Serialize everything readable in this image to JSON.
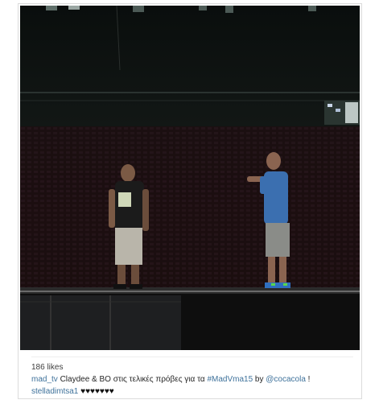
{
  "post": {
    "likes_text": "186 likes",
    "caption": {
      "username": "mad_tv",
      "text_before": " Claydee & BO στις τελικές πρόβες για τα ",
      "hashtag": "#MadVma15",
      "text_middle": " by ",
      "mention": "@cocacola",
      "text_after": " !"
    },
    "comment": {
      "username": "stelladimtsa1",
      "text": " ♥♥♥♥♥♥♥"
    }
  },
  "photo": {
    "icon": "photo-image",
    "colors": {
      "backdrop": "#0d1210",
      "stage": "#1a1a1a",
      "person1_shirt": "#1b1b1b",
      "person1_shorts": "#b9b5aa",
      "person2_shirt": "#3b6fb0",
      "person2_shorts": "#8a8c88"
    }
  }
}
